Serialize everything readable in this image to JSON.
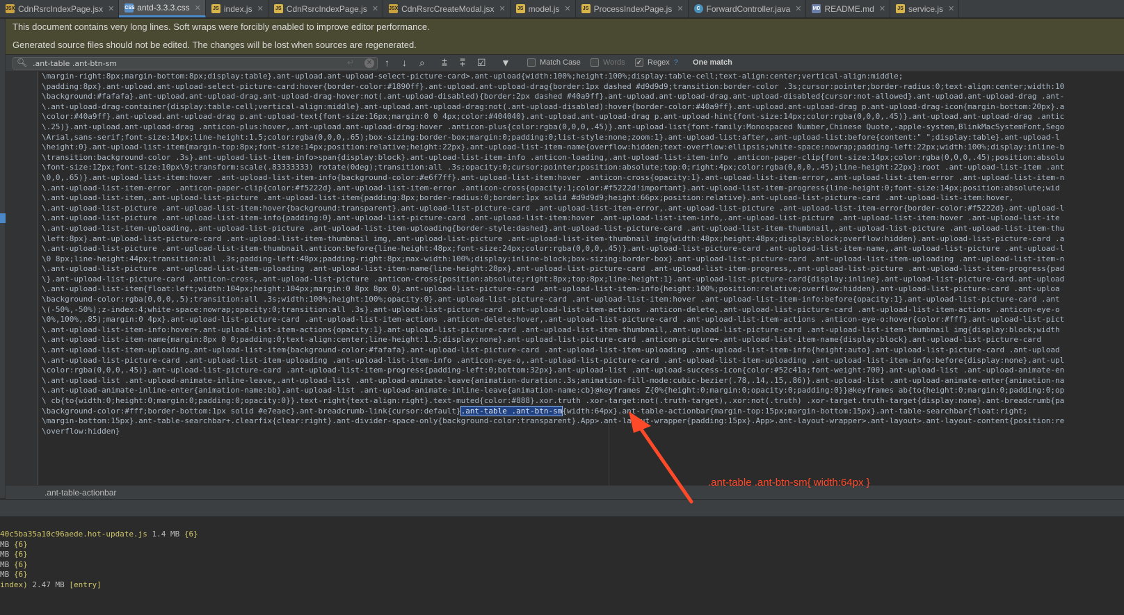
{
  "tabs": [
    {
      "label": "CdnRsrcIndexPage.jsx",
      "icon": "jsx-file-icon",
      "active": false
    },
    {
      "label": "antd-3.3.3.css",
      "icon": "css-file-icon",
      "active": true
    },
    {
      "label": "index.js",
      "icon": "js-file-icon",
      "active": false
    },
    {
      "label": "CdnRsrcIndexPage.js",
      "icon": "js-file-icon",
      "active": false
    },
    {
      "label": "CdnRsrcCreateModal.jsx",
      "icon": "jsx-file-icon",
      "active": false
    },
    {
      "label": "model.js",
      "icon": "js-file-icon",
      "active": false
    },
    {
      "label": "ProcessIndexPage.js",
      "icon": "js-file-icon",
      "active": false
    },
    {
      "label": "ForwardController.java",
      "icon": "java-file-icon",
      "active": false
    },
    {
      "label": "README.md",
      "icon": "md-file-icon",
      "active": false
    },
    {
      "label": "service.js",
      "icon": "js-file-icon",
      "active": false
    }
  ],
  "banner": {
    "line1": "This document contains very long lines. Soft wraps were forcibly enabled to improve editor performance.",
    "line2": "Generated source files should not be edited. The changes will be lost when sources are regenerated."
  },
  "find": {
    "query": ".ant-table .ant-btn-sm",
    "match_case_label": "Match Case",
    "words_label": "Words",
    "regex_label": "Regex",
    "regex_help": "?",
    "match_count": "One match"
  },
  "code_lines": [
    "\\margin-right:8px;margin-bottom:8px;display:table}.ant-upload.ant-upload-select-picture-card>.ant-upload{width:100%;height:100%;display:table-cell;text-align:center;vertical-align:middle;",
    "\\padding:8px}.ant-upload.ant-upload-select-picture-card:hover{border-color:#1890ff}.ant-upload.ant-upload-drag{border:1px dashed #d9d9d9;transition:border-color .3s;cursor:pointer;border-radius:0;text-align:center;width:10",
    "\\background:#fafafa}.ant-upload.ant-upload-drag.ant-upload-drag-hover:not(.ant-upload-disabled){border:2px dashed #40a9ff}.ant-upload.ant-upload-drag.ant-upload-disabled{cursor:not-allowed}.ant-upload.ant-upload-drag .ant-",
    "\\.ant-upload-drag-container{display:table-cell;vertical-align:middle}.ant-upload.ant-upload-drag:not(.ant-upload-disabled):hover{border-color:#40a9ff}.ant-upload.ant-upload-drag p.ant-upload-drag-icon{margin-bottom:20px}.a",
    "\\color:#40a9ff}.ant-upload.ant-upload-drag p.ant-upload-text{font-size:16px;margin:0 0 4px;color:#404040}.ant-upload.ant-upload-drag p.ant-upload-hint{font-size:14px;color:rgba(0,0,0,.45)}.ant-upload.ant-upload-drag .antic",
    "\\.25)}.ant-upload.ant-upload-drag .anticon-plus:hover,.ant-upload.ant-upload-drag:hover .anticon-plus{color:rgba(0,0,0,.45)}.ant-upload-list{font-family:Monospaced Number,Chinese Quote,-apple-system,BlinkMacSystemFont,Sego",
    "\\Arial,sans-serif;font-size:14px;line-height:1.5;color:rgba(0,0,0,.65);box-sizing:border-box;margin:0;padding:0;list-style:none;zoom:1}.ant-upload-list:after,.ant-upload-list:before{content:\" \";display:table}.ant-upload-l",
    "\\height:0}.ant-upload-list-item{margin-top:8px;font-size:14px;position:relative;height:22px}.ant-upload-list-item-name{overflow:hidden;text-overflow:ellipsis;white-space:nowrap;padding-left:22px;width:100%;display:inline-b",
    "\\transition:background-color .3s}.ant-upload-list-item-info>span{display:block}.ant-upload-list-item-info .anticon-loading,.ant-upload-list-item-info .anticon-paper-clip{font-size:14px;color:rgba(0,0,0,.45);position:absolu",
    "\\font-size:12px;font-size:10px\\9;transform:scale(.83333333) rotate(0deg);transition:all .3s;opacity:0;cursor:pointer;position:absolute;top:0;right:4px;color:rgba(0,0,0,.45);line-height:22px}:root .ant-upload-list-item .ant",
    "\\0,0,.65)}.ant-upload-list-item:hover .ant-upload-list-item-info{background-color:#e6f7ff}.ant-upload-list-item:hover .anticon-cross{opacity:1}.ant-upload-list-item-error,.ant-upload-list-item-error .ant-upload-list-item-n",
    "\\.ant-upload-list-item-error .anticon-paper-clip{color:#f5222d}.ant-upload-list-item-error .anticon-cross{opacity:1;color:#f5222d!important}.ant-upload-list-item-progress{line-height:0;font-size:14px;position:absolute;wid",
    "\\.ant-upload-list-item,.ant-upload-list-picture .ant-upload-list-item{padding:8px;border-radius:0;border:1px solid #d9d9d9;height:66px;position:relative}.ant-upload-list-picture-card .ant-upload-list-item:hover,",
    "\\.ant-upload-list-picture .ant-upload-list-item:hover{background:transparent}.ant-upload-list-picture-card .ant-upload-list-item-error,.ant-upload-list-picture .ant-upload-list-item-error{border-color:#f5222d}.ant-upload-l",
    "\\.ant-upload-list-picture .ant-upload-list-item-info{padding:0}.ant-upload-list-picture-card .ant-upload-list-item:hover .ant-upload-list-item-info,.ant-upload-list-picture .ant-upload-list-item:hover .ant-upload-list-ite",
    "\\.ant-upload-list-item-uploading,.ant-upload-list-picture .ant-upload-list-item-uploading{border-style:dashed}.ant-upload-list-picture-card .ant-upload-list-item-thumbnail,.ant-upload-list-picture .ant-upload-list-item-thu",
    "\\left:8px}.ant-upload-list-picture-card .ant-upload-list-item-thumbnail img,.ant-upload-list-picture .ant-upload-list-item-thumbnail img{width:48px;height:48px;display:block;overflow:hidden}.ant-upload-list-picture-card .a",
    "\\.ant-upload-list-picture .ant-upload-list-item-thumbnail.anticon:before{line-height:48px;font-size:24px;color:rgba(0,0,0,.45)}.ant-upload-list-picture-card .ant-upload-list-item-name,.ant-upload-list-picture .ant-upload-l",
    "\\0 8px;line-height:44px;transition:all .3s;padding-left:48px;padding-right:8px;max-width:100%;display:inline-block;box-sizing:border-box}.ant-upload-list-picture-card .ant-upload-list-item-uploading .ant-upload-list-item-n",
    "\\.ant-upload-list-picture .ant-upload-list-item-uploading .ant-upload-list-item-name{line-height:28px}.ant-upload-list-picture-card .ant-upload-list-item-progress,.ant-upload-list-picture .ant-upload-list-item-progress{pad",
    "\\}.ant-upload-list-picture-card .anticon-cross,.ant-upload-list-picture .anticon-cross{position:absolute;right:8px;top:8px;line-height:1}.ant-upload-list-picture-card{display:inline}.ant-upload-list-picture-card.ant-upload",
    "\\.ant-upload-list-item{float:left;width:104px;height:104px;margin:0 8px 8px 0}.ant-upload-list-picture-card .ant-upload-list-item-info{height:100%;position:relative;overflow:hidden}.ant-upload-list-picture-card .ant-uploa",
    "\\background-color:rgba(0,0,0,.5);transition:all .3s;width:100%;height:100%;opacity:0}.ant-upload-list-picture-card .ant-upload-list-item:hover .ant-upload-list-item-info:before{opacity:1}.ant-upload-list-picture-card .ant",
    "\\(-50%,-50%);z-index:4;white-space:nowrap;opacity:0;transition:all .3s}.ant-upload-list-picture-card .ant-upload-list-item-actions .anticon-delete,.ant-upload-list-picture-card .ant-upload-list-item-actions .anticon-eye-o",
    "\\0%,100%,.85);margin:0 4px}.ant-upload-list-picture-card .ant-upload-list-item-actions .anticon-delete:hover,.ant-upload-list-picture-card .ant-upload-list-item-actions .anticon-eye-o:hover{color:#fff}.ant-upload-list-pict",
    "\\.ant-upload-list-item-info:hover+.ant-upload-list-item-actions{opacity:1}.ant-upload-list-picture-card .ant-upload-list-item-thumbnail,.ant-upload-list-picture-card .ant-upload-list-item-thumbnail img{display:block;width",
    "\\.ant-upload-list-item-name{margin:8px 0 0;padding:0;text-align:center;line-height:1.5;display:none}.ant-upload-list-picture-card .anticon-picture+.ant-upload-list-item-name{display:block}.ant-upload-list-picture-card ",
    "\\.ant-upload-list-item-uploading.ant-upload-list-item{background-color:#fafafa}.ant-upload-list-picture-card .ant-upload-list-item-uploading .ant-upload-list-item-info{height:auto}.ant-upload-list-picture-card .ant-upload",
    "\\.ant-upload-list-picture-card .ant-upload-list-item-uploading .ant-upload-list-item-info .anticon-eye-o,.ant-upload-list-picture-card .ant-upload-list-item-uploading .ant-upload-list-item-info:before{display:none}.ant-upl",
    "\\color:rgba(0,0,0,.45)}.ant-upload-list-picture-card .ant-upload-list-item-progress{padding-left:0;bottom:32px}.ant-upload-list .ant-upload-success-icon{color:#52c41a;font-weight:700}.ant-upload-list .ant-upload-animate-en",
    "\\.ant-upload-list .ant-upload-animate-inline-leave,.ant-upload-list .ant-upload-animate-leave{animation-duration:.3s;animation-fill-mode:cubic-bezier(.78,.14,.15,.86)}.ant-upload-list .ant-upload-animate-enter{animation-na",
    "\\.ant-upload-animate-inline-enter{animation-name:bb}.ant-upload-list .ant-upload-animate-inline-leave{animation-name:cb}@keyframes Z{0%{height:0;margin:0;opacity:0;padding:0}}@keyframes ab{to{height:0;margin:0;padding:0;op",
    "\\ cb{to{width:0;height:0;margin:0;padding:0;opacity:0}}.text-right{text-align:right}.text-muted{color:#888}.xor.truth .xor-target:not(.truth-target),.xor:not(.truth) .xor-target.truth-target{display:none}.ant-breadcrumb{pa",
    "\\background-color:#fff;border-bottom:1px solid #e7eaec}.ant-breadcrumb-link{cursor:default}",
    "\\margin-bottom:15px}.ant-table-searchbar+.clearfix{clear:right}.ant-divider-space-only{background-color:transparent}.App>.ant-layout-wrapper{padding:15px}.App>.ant-layout-wrapper>.ant-layout>.ant-layout-content{position:re",
    "\\overflow:hidden}"
  ],
  "highlight": {
    "match_text": ".ant-table .ant-btn-sm",
    "rest": "{width:64px}",
    "after": ".ant-table-actionbar{margin-top:15px;margin-bottom:15px}.ant-table-searchbar{float:right;"
  },
  "status": {
    "breadcrumb": ".ant-table-actionbar"
  },
  "terminal": [
    {
      "name": "40c5ba35a10c96aede.hot-update.js",
      "size": "1.4 MB",
      "tag": "{6}"
    },
    {
      "name": "",
      "size": "MB",
      "tag": "{6}"
    },
    {
      "name": "",
      "size": "MB",
      "tag": "{6}"
    },
    {
      "name": "",
      "size": "MB",
      "tag": "{6}"
    },
    {
      "name": "",
      "size": "MB",
      "tag": "{6}"
    },
    {
      "name": "index)",
      "size": "2.47 MB",
      "tag": "[entry]"
    }
  ],
  "annotation": {
    "label": ".ant-table .ant-btn-sm{ width:64px }",
    "color": "#ff4a2a"
  }
}
